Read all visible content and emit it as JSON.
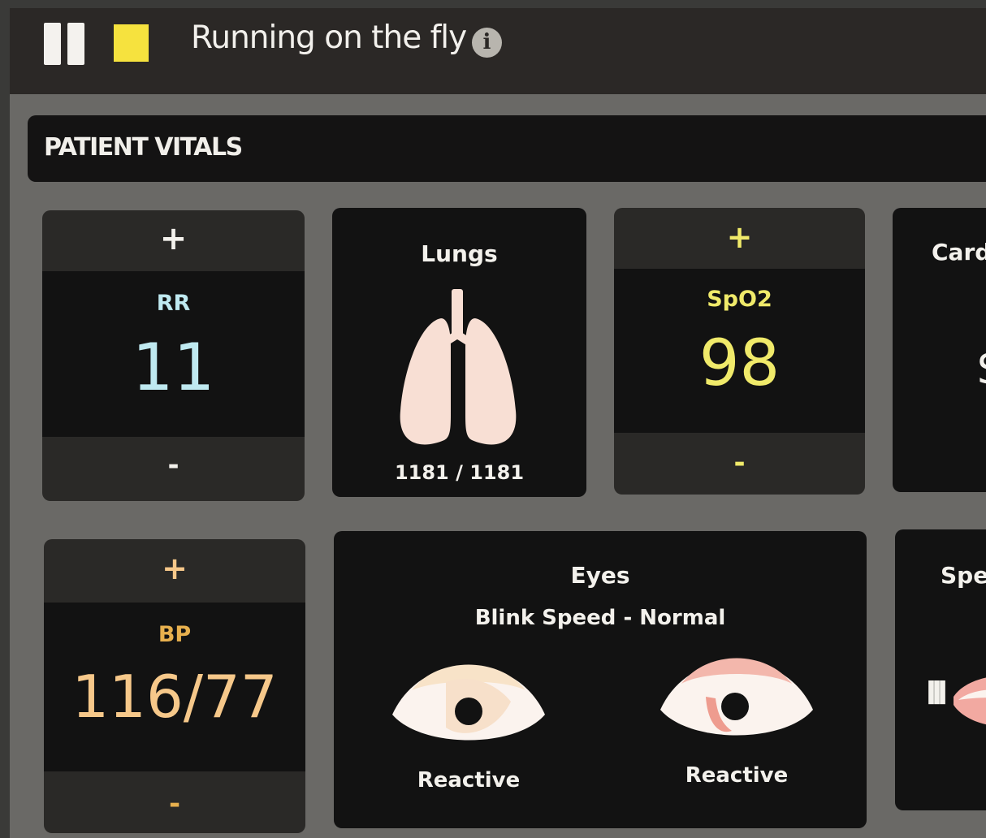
{
  "topbar": {
    "title": "Running on the fly",
    "info_glyph": "i",
    "stop_color": "#f6e23e"
  },
  "panel": {
    "title": "PATIENT VITALS"
  },
  "rr": {
    "plus": "+",
    "label": "RR",
    "value": "11",
    "minus": "-",
    "color": "#bfe9f0"
  },
  "lungs": {
    "label": "Lungs",
    "count": "1181 / 1181"
  },
  "spo2": {
    "plus": "+",
    "label": "SpO2",
    "value": "98",
    "minus": "-",
    "color": "#f0ea6a"
  },
  "cardiac": {
    "label": "Cardi",
    "value": "S"
  },
  "bp": {
    "plus": "+",
    "label": "BP",
    "value": "116/77",
    "minus": "-",
    "color": "#f6c88a"
  },
  "eyes": {
    "label": "Eyes",
    "blink": "Blink Speed - Normal",
    "left_status": "Reactive",
    "right_status": "Reactive"
  },
  "speech": {
    "label": "Spee",
    "icon_glyph": "lll"
  }
}
